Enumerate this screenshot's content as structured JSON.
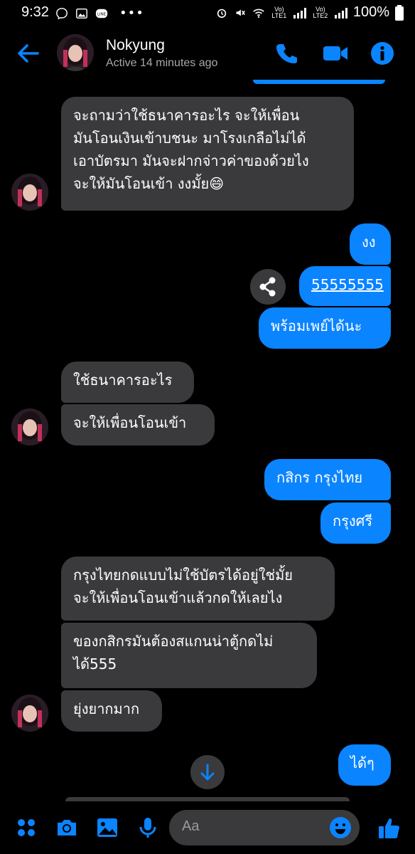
{
  "status_bar": {
    "time": "9:32",
    "dots": "•••",
    "battery": "100%",
    "net1": "Vo) LTE1",
    "net2": "Vo) LTE2"
  },
  "header": {
    "name": "Nokyung",
    "status": "Active 14 minutes ago"
  },
  "messages": {
    "m1": "จะถามว่าใช้ธนาคารอะไร จะให้เพื่อน\nมันโอนเงินเข้าบชนะ มาโรงเกลือไม่ได้\nเอาบัตรมา มันจะฝากจ่าวค่าของด้วยไง\nจะให้มันโอนเข้า งงมั้ย😄",
    "m2": "งง",
    "m3": "55555555",
    "m4": "พร้อมเพย์ได้นะ",
    "m5": "ใช้ธนาคารอะไร",
    "m6": "จะให้เพื่อนโอนเข้า",
    "m7": "กสิกร กรุงไทย",
    "m8": "กรุงศรี",
    "m9": "กรุงไทยกดแบบไม่ใช้บัตรได้อยู่ใช่มั้ย\nจะให้เพื่อนโอนเข้าแล้วกดให้เลยไง",
    "m10": "ของกสิกรมันต้องสแกนน่าตู้กดไม่\nได้555",
    "m11": "ยุ่งยากมาก",
    "m12": "ได้ๆ"
  },
  "composer": {
    "placeholder": "Aa"
  },
  "colors": {
    "accent": "#0a84ff",
    "incoming_bubble": "#3a3a3c",
    "background": "#000000"
  }
}
